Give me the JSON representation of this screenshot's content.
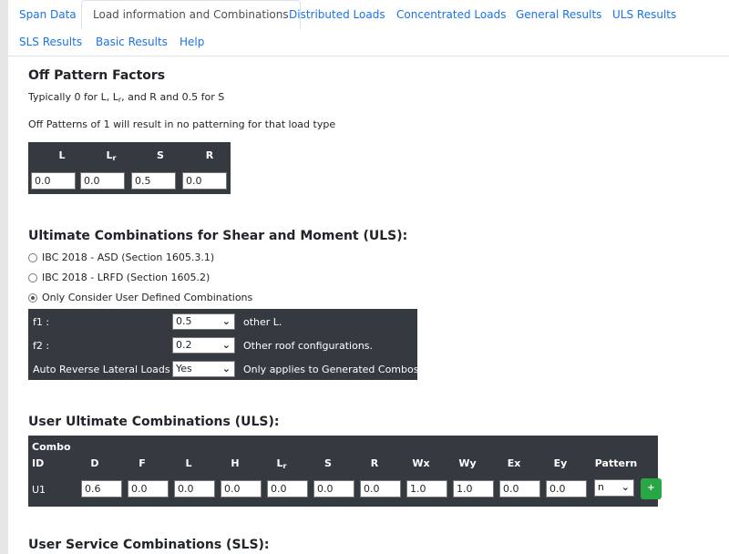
{
  "tabs": [
    {
      "label": "Span Data"
    },
    {
      "label": "Load information and Combinations"
    },
    {
      "label": "Distributed Loads"
    },
    {
      "label": "Concentrated Loads"
    },
    {
      "label": "General Results"
    },
    {
      "label": "ULS Results"
    },
    {
      "label": "SLS Results"
    },
    {
      "label": "Basic Results"
    },
    {
      "label": "Help"
    }
  ],
  "off_pattern": {
    "title": "Off Pattern Factors",
    "note1_pre": "Typically 0 for L, L",
    "note1_sub": "r",
    "note1_post": ", and R and 0.5 for S",
    "note2": "Off Patterns of 1 will result in no patterning for that load type",
    "headers": {
      "l": "L",
      "lr_main": "L",
      "lr_sub": "r",
      "s": "S",
      "r": "R"
    },
    "values": {
      "l": "0.0",
      "lr": "0.0",
      "s": "0.5",
      "r": "0.0"
    }
  },
  "uls": {
    "title": "Ultimate Combinations for Shear and Moment (ULS):",
    "options": [
      {
        "label": "IBC 2018 - ASD (Section 1605.3.1)",
        "checked": false
      },
      {
        "label": "IBC 2018 - LRFD (Section 1605.2)",
        "checked": false
      },
      {
        "label": "Only Consider User Defined Combinations",
        "checked": true
      }
    ],
    "rows": [
      {
        "label": "f1 :",
        "value": "0.5",
        "note": "other L."
      },
      {
        "label": "f2 :",
        "value": "0.2",
        "note": "Other roof configurations."
      },
      {
        "label": "Auto Reverse Lateral Loads :",
        "value": "Yes",
        "note": "Only applies to Generated Combos."
      }
    ]
  },
  "user_uls": {
    "title": "User Ultimate Combinations (ULS):",
    "headers": {
      "combo_id_1": "Combo",
      "combo_id_2": "ID",
      "d": "D",
      "f": "F",
      "l": "L",
      "h": "H",
      "lr_main": "L",
      "lr_sub": "r",
      "s": "S",
      "r": "R",
      "wx": "Wx",
      "wy": "Wy",
      "ex": "Ex",
      "ey": "Ey",
      "pattern": "Pattern"
    },
    "row": {
      "id": "U1",
      "d": "0.6",
      "f": "0.0",
      "l": "0.0",
      "h": "0.0",
      "lr": "0.0",
      "s": "0.0",
      "r": "0.0",
      "wx": "1.0",
      "wy": "1.0",
      "ex": "0.0",
      "ey": "0.0",
      "pattern": "n",
      "add_label": "+"
    }
  },
  "sls": {
    "title": "User Service Combinations (SLS):"
  },
  "colors": {
    "tab_link": "#1a73e8",
    "dark_table": "#343a40",
    "add_button": "#28a745"
  }
}
